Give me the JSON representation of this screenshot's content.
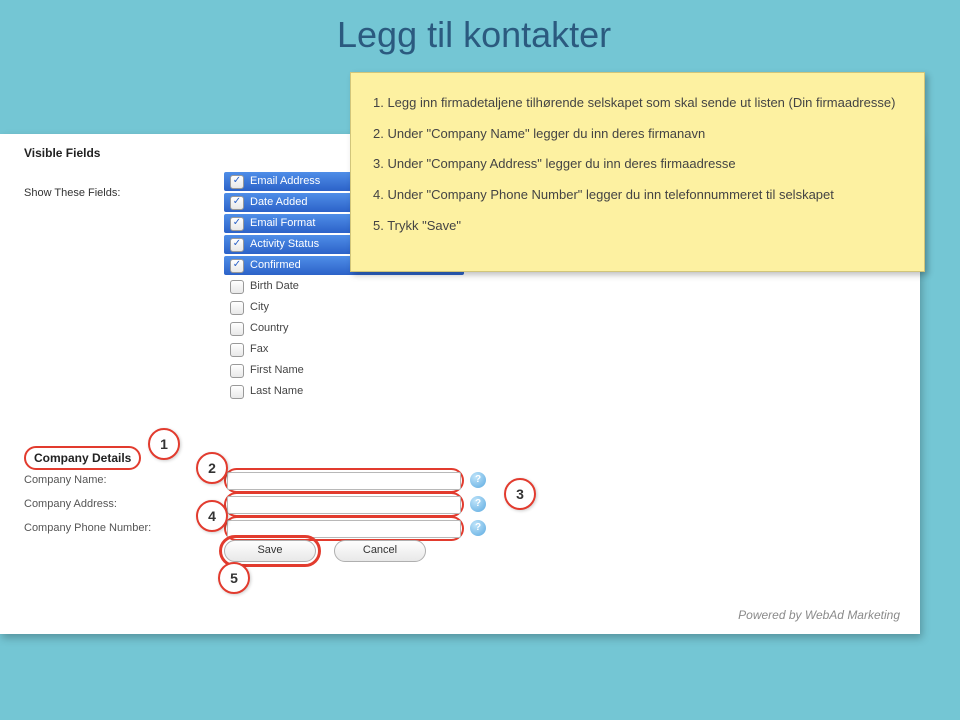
{
  "title": "Legg til kontakter",
  "help": {
    "l1": "1. Legg inn firmadetaljene tilhørende selskapet som skal sende ut listen (Din firmaadresse)",
    "l2": "2. Under \"Company Name\" legger du inn deres firmanavn",
    "l3": "3. Under \"Company Address\" legger du inn deres firmaadresse",
    "l4": "4. Under \"Company Phone Number\" legger du inn telefonnummeret til selskapet",
    "l5": "5. Trykk \"Save\""
  },
  "visible_fields_header": "Visible Fields",
  "show_these_fields": "Show These Fields:",
  "fields": [
    {
      "label": "Email Address",
      "checked": true,
      "blue": true
    },
    {
      "label": "Date Added",
      "checked": true,
      "blue": true
    },
    {
      "label": "Email Format",
      "checked": true,
      "blue": true
    },
    {
      "label": "Activity Status",
      "checked": true,
      "blue": true
    },
    {
      "label": "Confirmed",
      "checked": true,
      "blue": true
    },
    {
      "label": "Birth Date",
      "checked": false,
      "blue": false
    },
    {
      "label": "City",
      "checked": false,
      "blue": false
    },
    {
      "label": "Country",
      "checked": false,
      "blue": false
    },
    {
      "label": "Fax",
      "checked": false,
      "blue": false
    },
    {
      "label": "First Name",
      "checked": false,
      "blue": false
    },
    {
      "label": "Last Name",
      "checked": false,
      "blue": false
    }
  ],
  "company_details_header": "Company Details",
  "company_name_label": "Company Name:",
  "company_address_label": "Company Address:",
  "company_phone_label": "Company Phone Number:",
  "save_label": "Save",
  "cancel_label": "Cancel",
  "footer": "Powered by WebAd Marketing",
  "callouts": {
    "c1": "1",
    "c2": "2",
    "c3": "3",
    "c4": "4",
    "c5": "5"
  }
}
